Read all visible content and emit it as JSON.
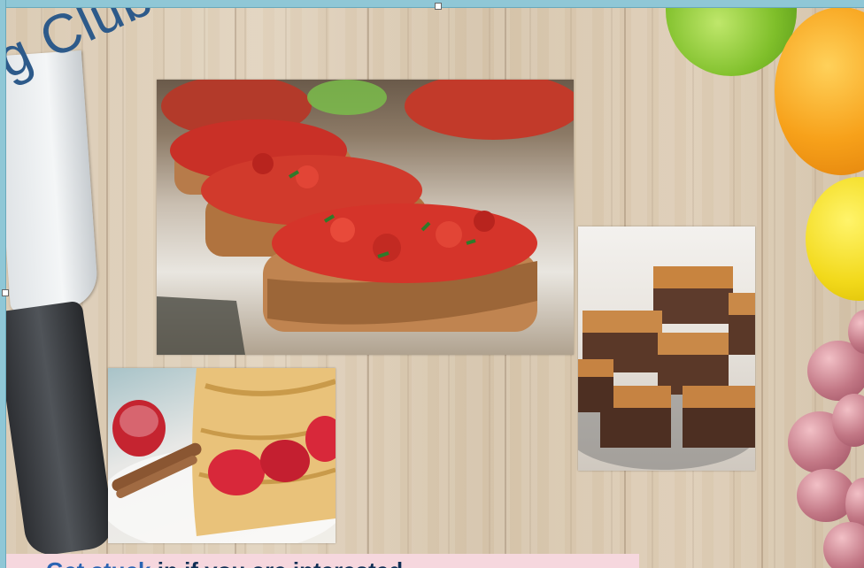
{
  "slide": {
    "title": "Cooking Club",
    "title_visible": "ing Club",
    "bottom_text_link": "Get stuck",
    "bottom_text_rest": "in if you are interested"
  },
  "images": [
    {
      "name": "bruschetta-photo"
    },
    {
      "name": "crepes-photo"
    },
    {
      "name": "fudge-photo"
    }
  ],
  "colors": {
    "title": "#2d5a8a",
    "selection": "#8fc7d6",
    "band": "#f6d7de"
  }
}
